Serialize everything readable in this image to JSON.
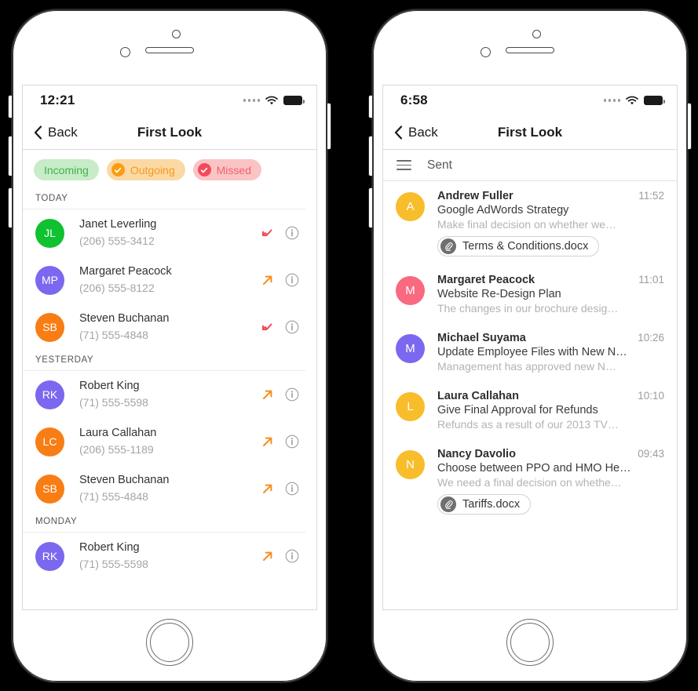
{
  "phones": {
    "left": {
      "status": {
        "time": "12:21",
        "signal_icon": "signal-dots-icon",
        "wifi_icon": "wifi-icon",
        "battery_icon": "battery-full-icon"
      },
      "nav": {
        "back_label": "Back",
        "back_icon": "chevron-left-icon",
        "title": "First Look"
      },
      "filters": [
        {
          "label": "Incoming",
          "selected": false,
          "bg": "#c7ecc7",
          "fg": "#3bb44a",
          "check_bg": "#3bb44a"
        },
        {
          "label": "Outgoing",
          "selected": true,
          "bg": "#fbd9a4",
          "fg": "#f59a1b",
          "check_bg": "#f99d13"
        },
        {
          "label": "Missed",
          "selected": true,
          "bg": "#fac4c4",
          "fg": "#f4606d",
          "check_bg": "#f4495c"
        }
      ],
      "sections": [
        {
          "title": "TODAY",
          "calls": [
            {
              "initials": "JL",
              "color": "#10c130",
              "name": "Janet Leverling",
              "phone": "(206) 555-3412",
              "direction": "missed",
              "dir_color": "#f6414f",
              "info_icon": "info-circle-icon"
            },
            {
              "initials": "MP",
              "color": "#7b68f0",
              "name": "Margaret Peacock",
              "phone": "(206) 555-8122",
              "direction": "outgoing",
              "dir_color": "#f78e1e",
              "info_icon": "info-circle-icon"
            },
            {
              "initials": "SB",
              "color": "#f87d14",
              "name": "Steven Buchanan",
              "phone": "(71) 555-4848",
              "direction": "missed",
              "dir_color": "#f6414f",
              "info_icon": "info-circle-icon"
            }
          ]
        },
        {
          "title": "YESTERDAY",
          "calls": [
            {
              "initials": "RK",
              "color": "#7b68f0",
              "name": "Robert King",
              "phone": "(71) 555-5598",
              "direction": "outgoing",
              "dir_color": "#f78e1e",
              "info_icon": "info-circle-icon"
            },
            {
              "initials": "LC",
              "color": "#f87d14",
              "name": "Laura Callahan",
              "phone": "(206) 555-1189",
              "direction": "outgoing",
              "dir_color": "#f78e1e",
              "info_icon": "info-circle-icon"
            },
            {
              "initials": "SB",
              "color": "#f87d14",
              "name": "Steven Buchanan",
              "phone": "(71) 555-4848",
              "direction": "outgoing",
              "dir_color": "#f78e1e",
              "info_icon": "info-circle-icon"
            }
          ]
        },
        {
          "title": "MONDAY",
          "calls": [
            {
              "initials": "RK",
              "color": "#7b68f0",
              "name": "Robert King",
              "phone": "(71) 555-5598",
              "direction": "outgoing",
              "dir_color": "#f78e1e",
              "info_icon": "info-circle-icon"
            }
          ]
        }
      ]
    },
    "right": {
      "status": {
        "time": "6:58",
        "signal_icon": "signal-dots-icon",
        "wifi_icon": "wifi-icon",
        "battery_icon": "battery-full-icon"
      },
      "nav": {
        "back_label": "Back",
        "back_icon": "chevron-left-icon",
        "title": "First Look"
      },
      "folder": {
        "menu_icon": "hamburger-menu-icon",
        "name": "Sent"
      },
      "mails": [
        {
          "initial": "A",
          "color": "#f8bd2a",
          "from": "Andrew Fuller",
          "time": "11:52",
          "subject": "Google AdWords Strategy",
          "preview": "Make final decision on whether we…",
          "attachment": {
            "name": "Terms & Conditions.docx",
            "icon": "paperclip-icon"
          }
        },
        {
          "initial": "M",
          "color": "#f9697f",
          "from": "Margaret Peacock",
          "time": "11:01",
          "subject": "Website Re-Design Plan",
          "preview": "The changes in our brochure desig…",
          "attachment": null
        },
        {
          "initial": "M",
          "color": "#7b68f0",
          "from": "Michael Suyama",
          "time": "10:26",
          "subject": "Update Employee Files with New N…",
          "preview": "Management has approved new N…",
          "attachment": null
        },
        {
          "initial": "L",
          "color": "#f8bd2a",
          "from": "Laura Callahan",
          "time": "10:10",
          "subject": "Give Final Approval for Refunds",
          "preview": "Refunds as a result of our 2013 TV…",
          "attachment": null
        },
        {
          "initial": "N",
          "color": "#f8bd2a",
          "from": "Nancy Davolio",
          "time": "09:43",
          "subject": "Choose between PPO and HMO He…",
          "preview": "We need a final decision on whethe…",
          "attachment": {
            "name": "Tariffs.docx",
            "icon": "paperclip-icon"
          }
        }
      ]
    }
  }
}
